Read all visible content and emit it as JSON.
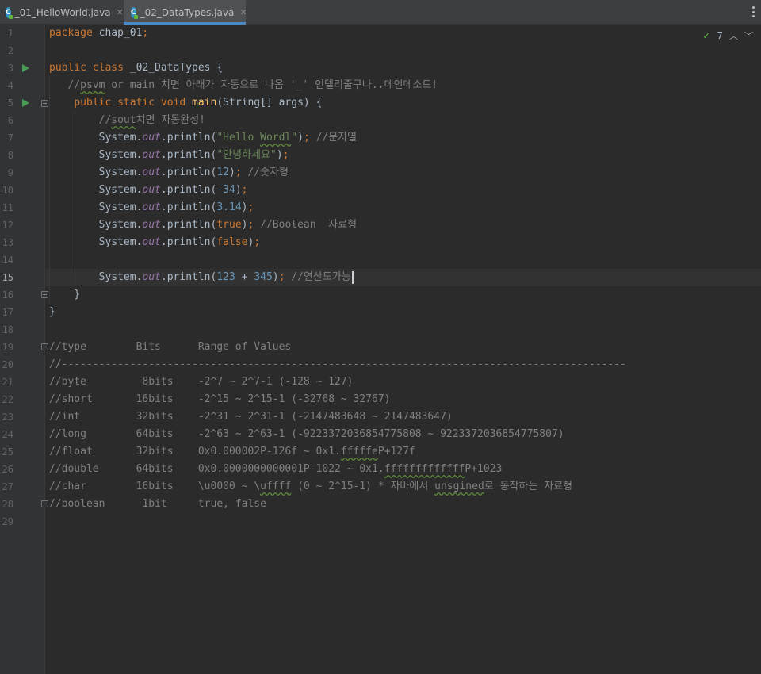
{
  "tabs": [
    {
      "label": "_01_HelloWorld.java",
      "icon": "java-class-icon",
      "close": "✕",
      "active": false
    },
    {
      "label": "_02_DataTypes.java",
      "icon": "java-class-icon",
      "close": "✕",
      "active": true
    }
  ],
  "inspection": {
    "count": "7",
    "icon": "inspection-check-icon",
    "prev": "︿",
    "next": "﹀"
  },
  "caret_line": 15,
  "colors": {
    "keyword": "#cc7832",
    "string": "#6a8759",
    "number": "#6897bb",
    "comment": "#808080",
    "field": "#9876aa",
    "method": "#ffc66d",
    "background": "#2b2b2b"
  },
  "lines": [
    {
      "n": "1",
      "t": [
        [
          "kw",
          "package"
        ],
        [
          "p",
          " chap_01"
        ],
        [
          "kw",
          ";"
        ]
      ]
    },
    {
      "n": "2",
      "t": []
    },
    {
      "n": "3",
      "t": [
        [
          "kw",
          "public class"
        ],
        [
          "p",
          " _02_DataTypes {"
        ]
      ]
    },
    {
      "n": "4",
      "t": [
        [
          "cm",
          "   //"
        ],
        [
          "cmw",
          "psvm"
        ],
        [
          "cm",
          " or main 치면 아래가 자동으로 나옴 '_' 인텔리줄구나..메인메소드!"
        ]
      ]
    },
    {
      "n": "5",
      "t": [
        [
          "p",
          "    "
        ],
        [
          "kw",
          "public static void "
        ],
        [
          "meth",
          "main"
        ],
        [
          "p",
          "(String[] args) {"
        ]
      ]
    },
    {
      "n": "6",
      "t": [
        [
          "cm",
          "        //"
        ],
        [
          "cmw",
          "sout"
        ],
        [
          "cm",
          "치면 자동완성!"
        ]
      ]
    },
    {
      "n": "7",
      "t": [
        [
          "p",
          "        System."
        ],
        [
          "fld",
          "out"
        ],
        [
          "p",
          ".println("
        ],
        [
          "str",
          "\"Hello "
        ],
        [
          "strw",
          "Wordl"
        ],
        [
          "str",
          "\""
        ],
        [
          "p",
          ")"
        ],
        [
          "kw",
          ";"
        ],
        [
          "cm",
          " //문자열"
        ]
      ]
    },
    {
      "n": "8",
      "t": [
        [
          "p",
          "        System."
        ],
        [
          "fld",
          "out"
        ],
        [
          "p",
          ".println("
        ],
        [
          "str",
          "\"안녕하세요\""
        ],
        [
          "p",
          ")"
        ],
        [
          "kw",
          ";"
        ]
      ]
    },
    {
      "n": "9",
      "t": [
        [
          "p",
          "        System."
        ],
        [
          "fld",
          "out"
        ],
        [
          "p",
          ".println("
        ],
        [
          "num",
          "12"
        ],
        [
          "p",
          ")"
        ],
        [
          "kw",
          ";"
        ],
        [
          "cm",
          " //숫자형"
        ]
      ]
    },
    {
      "n": "10",
      "t": [
        [
          "p",
          "        System."
        ],
        [
          "fld",
          "out"
        ],
        [
          "p",
          ".println("
        ],
        [
          "num",
          "-34"
        ],
        [
          "p",
          ")"
        ],
        [
          "kw",
          ";"
        ]
      ]
    },
    {
      "n": "11",
      "t": [
        [
          "p",
          "        System."
        ],
        [
          "fld",
          "out"
        ],
        [
          "p",
          ".println("
        ],
        [
          "num",
          "3.14"
        ],
        [
          "p",
          ")"
        ],
        [
          "kw",
          ";"
        ]
      ]
    },
    {
      "n": "12",
      "t": [
        [
          "p",
          "        System."
        ],
        [
          "fld",
          "out"
        ],
        [
          "p",
          ".println("
        ],
        [
          "kw",
          "true"
        ],
        [
          "p",
          ")"
        ],
        [
          "kw",
          ";"
        ],
        [
          "cm",
          " //Boolean  자료형"
        ]
      ]
    },
    {
      "n": "13",
      "t": [
        [
          "p",
          "        System."
        ],
        [
          "fld",
          "out"
        ],
        [
          "p",
          ".println("
        ],
        [
          "kw",
          "false"
        ],
        [
          "p",
          ")"
        ],
        [
          "kw",
          ";"
        ]
      ]
    },
    {
      "n": "14",
      "t": []
    },
    {
      "n": "15",
      "t": [
        [
          "p",
          "        System."
        ],
        [
          "fld",
          "out"
        ],
        [
          "p",
          ".println("
        ],
        [
          "num",
          "123"
        ],
        [
          "p",
          " + "
        ],
        [
          "num",
          "345"
        ],
        [
          "p",
          ")"
        ],
        [
          "kw",
          ";"
        ],
        [
          "cm",
          " //연산도가능"
        ]
      ]
    },
    {
      "n": "16",
      "t": [
        [
          "p",
          "    }"
        ]
      ]
    },
    {
      "n": "17",
      "t": [
        [
          "p",
          "}"
        ]
      ]
    },
    {
      "n": "18",
      "t": []
    },
    {
      "n": "19",
      "t": [
        [
          "cm",
          "//type        Bits      Range of Values"
        ]
      ]
    },
    {
      "n": "20",
      "t": [
        [
          "cm",
          "//-------------------------------------------------------------------------------------------"
        ]
      ]
    },
    {
      "n": "21",
      "t": [
        [
          "cm",
          "//byte         8bits    -2^7 ~ 2^7-1 (-128 ~ 127)"
        ]
      ]
    },
    {
      "n": "22",
      "t": [
        [
          "cm",
          "//short       16bits    -2^15 ~ 2^15-1 (-32768 ~ 32767)"
        ]
      ]
    },
    {
      "n": "23",
      "t": [
        [
          "cm",
          "//int         32bits    -2^31 ~ 2^31-1 (-2147483648 ~ 2147483647)"
        ]
      ]
    },
    {
      "n": "24",
      "t": [
        [
          "cm",
          "//long        64bits    -2^63 ~ 2^63-1 (-9223372036854775808 ~ 9223372036854775807)"
        ]
      ]
    },
    {
      "n": "25",
      "t": [
        [
          "cm",
          "//float       32bits    0x0.000002P-126f ~ 0x1."
        ],
        [
          "cmw",
          "fffffe"
        ],
        [
          "cm",
          "P+127f"
        ]
      ]
    },
    {
      "n": "26",
      "t": [
        [
          "cm",
          "//double      64bits    0x0.0000000000001P-1022 ~ 0x1."
        ],
        [
          "cmw",
          "fffffffffffff"
        ],
        [
          "cm",
          "P+1023"
        ]
      ]
    },
    {
      "n": "27",
      "t": [
        [
          "cm",
          "//char        16bits    \\u0000 ~ \\"
        ],
        [
          "cmw",
          "uffff"
        ],
        [
          "cm",
          " (0 ~ 2^15-1) * 자바에서 "
        ],
        [
          "cmw",
          "unsgined"
        ],
        [
          "cm",
          "로 동작하는 자료형"
        ]
      ]
    },
    {
      "n": "28",
      "t": [
        [
          "cm",
          "//boolean      1bit     true, false"
        ]
      ]
    },
    {
      "n": "29",
      "t": []
    }
  ]
}
